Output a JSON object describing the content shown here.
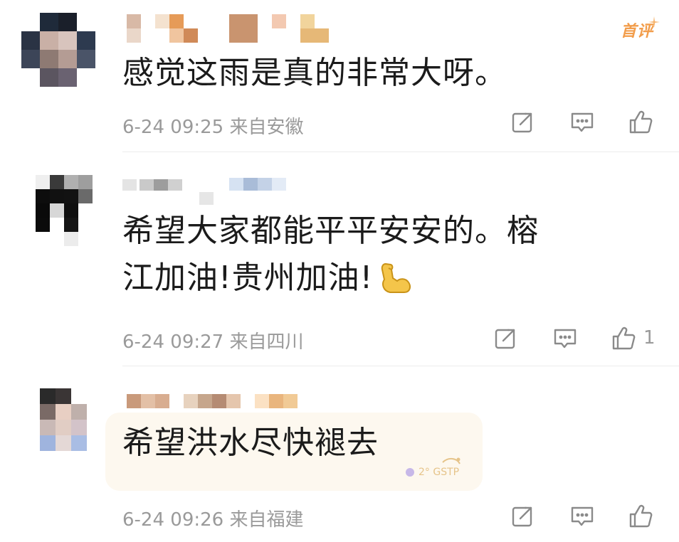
{
  "comments": [
    {
      "text": "感觉这雨是真的非常大呀。",
      "meta": "6-24 09:25 来自安徽",
      "badge": "首评",
      "like_count": ""
    },
    {
      "text_line1": "希望大家都能平平安安的。榕",
      "text_line2": "江加油!贵州加油!",
      "meta": "6-24 09:27 来自四川",
      "like_count": "1",
      "emoji": "flexed-biceps"
    },
    {
      "text": "希望洪水尽快褪去",
      "meta": "6-24 09:26 来自福建",
      "like_count": "",
      "sticker_text": "2° GSTP"
    }
  ],
  "icons": [
    "share-icon",
    "reply-icon",
    "like-icon"
  ],
  "colors": {
    "meta_gray": "#9a9a9a",
    "badge_orange": "#f29d4b",
    "divider": "#ececec"
  }
}
